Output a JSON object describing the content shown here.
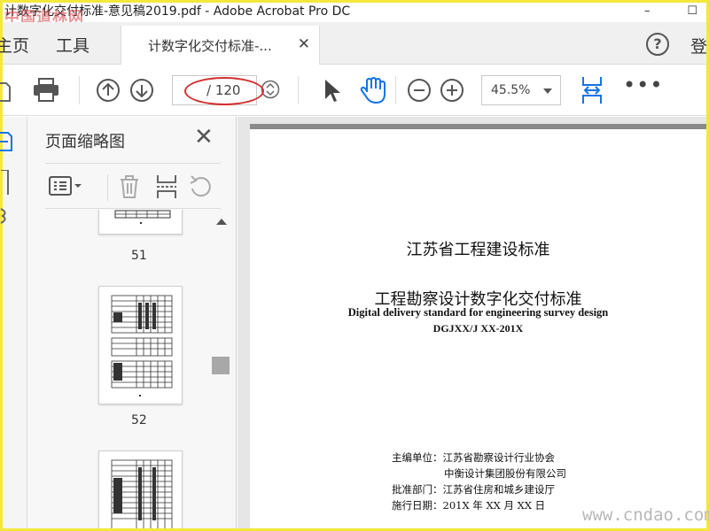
{
  "window": {
    "title": "计数字化交付标准-意见稿2019.pdf - Adobe Acrobat Pro DC",
    "minimize": "–",
    "maximize": "☐"
  },
  "watermark_top": "中国道林网",
  "watermark_bottom": "www.cndao.com",
  "tabs": {
    "home": "主页",
    "tools": "工具",
    "document_tab": "计数字化交付标准-...",
    "close": "✕",
    "help": "?",
    "login": "登"
  },
  "toolbar": {
    "page_current": "",
    "page_total": "/ 120",
    "zoom": "45.5%",
    "more": "•••"
  },
  "thumbnail_panel": {
    "title": "页面缩略图",
    "close": "✕",
    "pages": [
      "51",
      "52"
    ]
  },
  "document": {
    "title_cn": "江苏省工程建设标准",
    "subtitle_cn": "工程勘察设计数字化交付标准",
    "subtitle_en": "Digital delivery standard for engineering survey design",
    "code": "DGJXX/J XX-201X",
    "meta": [
      {
        "label": "主编单位：",
        "value": "江苏省勘察设计行业协会"
      },
      {
        "label": "",
        "value": "中衡设计集团股份有限公司"
      },
      {
        "label": "批准部门：",
        "value": "江苏省住房和城乡建设厅"
      },
      {
        "label": "施行日期：",
        "value": "201X 年 XX 月 XX 日"
      }
    ]
  },
  "colors": {
    "accent_blue": "#1473e6",
    "annotation_red": "#d23030",
    "frame_yellow": "#f4e83a"
  }
}
